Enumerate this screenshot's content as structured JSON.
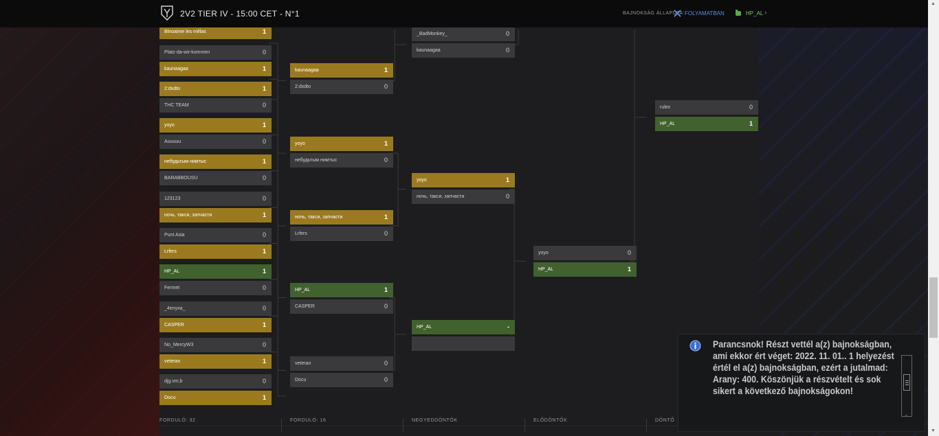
{
  "header": {
    "title": "2V2 TIER IV - 15:00 CET - N°1",
    "status_label": "BAJNOKSÁG ÁLLAPOTA:",
    "status_value": "FOLYAMATBAN",
    "user_name": "HP_AL",
    "user_chevron": "›"
  },
  "colors": {
    "gold": "#9b7a1f",
    "green": "#41612e",
    "slot": "#3a3a3c",
    "status_blue": "#5b8de0"
  },
  "rounds": [
    "FORDULÓ: 32",
    "FORDULÓ: 16",
    "NEGYEDDÖNTŐK",
    "ELŐDÖNTŐK",
    "DÖNTŐ"
  ],
  "bracket": {
    "round32": [
      {
        "name": "Blnoaime les mêlas",
        "score": "1",
        "state": "gold"
      },
      {
        "name": "Platz-da-wir-kommen",
        "score": "0",
        "state": "plain"
      },
      {
        "name": "kaunaagaa",
        "score": "1",
        "state": "gold"
      },
      {
        "name": "2:dxdto",
        "score": "1",
        "state": "gold"
      },
      {
        "name": "THC TEAM",
        "score": "0",
        "state": "plain"
      },
      {
        "name": "yoyo",
        "score": "1",
        "state": "gold"
      },
      {
        "name": "Auuuuu",
        "score": "0",
        "state": "plain"
      },
      {
        "name": "небудьтым нимтыс",
        "score": "1",
        "state": "gold"
      },
      {
        "name": "BARABBOUSU",
        "score": "0",
        "state": "plain"
      },
      {
        "name": "123123",
        "score": "0",
        "state": "plain"
      },
      {
        "name": "ночь, такси, запчасти",
        "score": "1",
        "state": "gold"
      },
      {
        "name": "Punt Asia",
        "score": "0",
        "state": "plain"
      },
      {
        "name": "Lrfers",
        "score": "1",
        "state": "gold"
      },
      {
        "name": "HP_AL",
        "score": "1",
        "state": "green"
      },
      {
        "name": "Fermet",
        "score": "0",
        "state": "plain"
      },
      {
        "name": "_4enyxa_",
        "score": "0",
        "state": "plain"
      },
      {
        "name": "CASPER",
        "score": "1",
        "state": "gold"
      },
      {
        "name": "No_MercyW3",
        "score": "0",
        "state": "plain"
      },
      {
        "name": "veteran",
        "score": "1",
        "state": "gold"
      },
      {
        "name": "djg.vm,b",
        "score": "0",
        "state": "plain"
      },
      {
        "name": "Docu",
        "score": "1",
        "state": "gold"
      }
    ],
    "round16": [
      {
        "name": "kaunaagaa",
        "score": "1",
        "state": "gold"
      },
      {
        "name": "2:dxdto",
        "score": "0",
        "state": "plain"
      },
      {
        "name": "yoyo",
        "score": "1",
        "state": "gold"
      },
      {
        "name": "небудьтым нимтыс",
        "score": "0",
        "state": "plain"
      },
      {
        "name": "ночь, такси, запчасти",
        "score": "1",
        "state": "gold"
      },
      {
        "name": "Lrfers",
        "score": "0",
        "state": "plain"
      },
      {
        "name": "HP_AL",
        "score": "1",
        "state": "green"
      },
      {
        "name": "CASPER",
        "score": "0",
        "state": "plain"
      },
      {
        "name": "veteran",
        "score": "0",
        "state": "plain"
      },
      {
        "name": "Docu",
        "score": "0",
        "state": "plain"
      }
    ],
    "quarter": [
      {
        "name": "_BadMonkey_",
        "score": "0",
        "state": "plain"
      },
      {
        "name": "kaunaagaa",
        "score": "0",
        "state": "plain"
      },
      {
        "name": "yoyo",
        "score": "1",
        "state": "gold"
      },
      {
        "name": "ночь, такси, запчасти",
        "score": "0",
        "state": "plain"
      },
      {
        "name": "HP_AL",
        "score": "-",
        "state": "green"
      },
      {
        "name": "",
        "score": "",
        "state": "plain"
      }
    ],
    "semi": [
      {
        "name": "yoyo",
        "score": "0",
        "state": "plain"
      },
      {
        "name": "HP_AL",
        "score": "1",
        "state": "green"
      }
    ],
    "final": [
      {
        "name": "rulex",
        "score": "0",
        "state": "plain"
      },
      {
        "name": "HP_AL",
        "score": "1",
        "state": "green"
      }
    ]
  },
  "notification": {
    "text": "Parancsnok! Részt vettél a(z) bajnokságban, ami ekkor ért véget: 2022. 11. 01.. 1 helyezést értél el a(z) bajnokságban, ezért a jutalmad: Arany: 400. Köszönjük a részvételt és sok sikert a következő bajnokságokon!"
  }
}
